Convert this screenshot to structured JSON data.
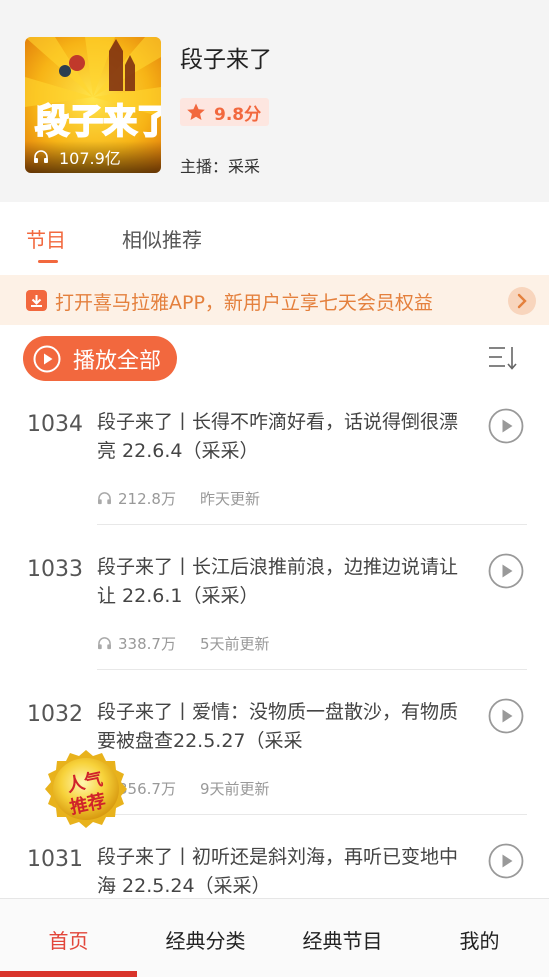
{
  "album": {
    "title": "段子来了",
    "rating": "9.8分",
    "host": "主播：采采",
    "plays": "107.9亿",
    "cover_text": "段子来了"
  },
  "tabs": [
    {
      "label": "节目",
      "active": true
    },
    {
      "label": "相似推荐",
      "active": false
    }
  ],
  "banner": {
    "text": "打开喜马拉雅APP，新用户立享七天会员权益"
  },
  "play_all": {
    "label": "播放全部"
  },
  "episodes": [
    {
      "number": "1034",
      "title": "段子来了丨长得不咋滴好看，话说得倒很漂亮 22.6.4（采采）",
      "plays": "212.8万",
      "updated": "昨天更新"
    },
    {
      "number": "1033",
      "title": "段子来了丨长江后浪推前浪，边推边说请让让 22.6.1（采采）",
      "plays": "338.7万",
      "updated": "5天前更新"
    },
    {
      "number": "1032",
      "title": "段子来了丨爱情：没物质一盘散沙，有物质要被盘查22.5.27（采采",
      "plays": "356.7万",
      "updated": "9天前更新"
    },
    {
      "number": "1031",
      "title": "段子来了丨初听还是斜刘海，再听已变地中海 22.5.24（采采）",
      "plays": "",
      "updated": ""
    }
  ],
  "badge": {
    "line1": "人气",
    "line2": "推荐"
  },
  "nav": [
    {
      "label": "首页",
      "active": true
    },
    {
      "label": "经典分类",
      "active": false
    },
    {
      "label": "经典节目",
      "active": false
    },
    {
      "label": "我的",
      "active": false
    }
  ],
  "colors": {
    "accent": "#f2683e",
    "banner_bg": "#fdf1e6",
    "banner_text": "#e4803d",
    "nav_active": "#e2463a"
  }
}
